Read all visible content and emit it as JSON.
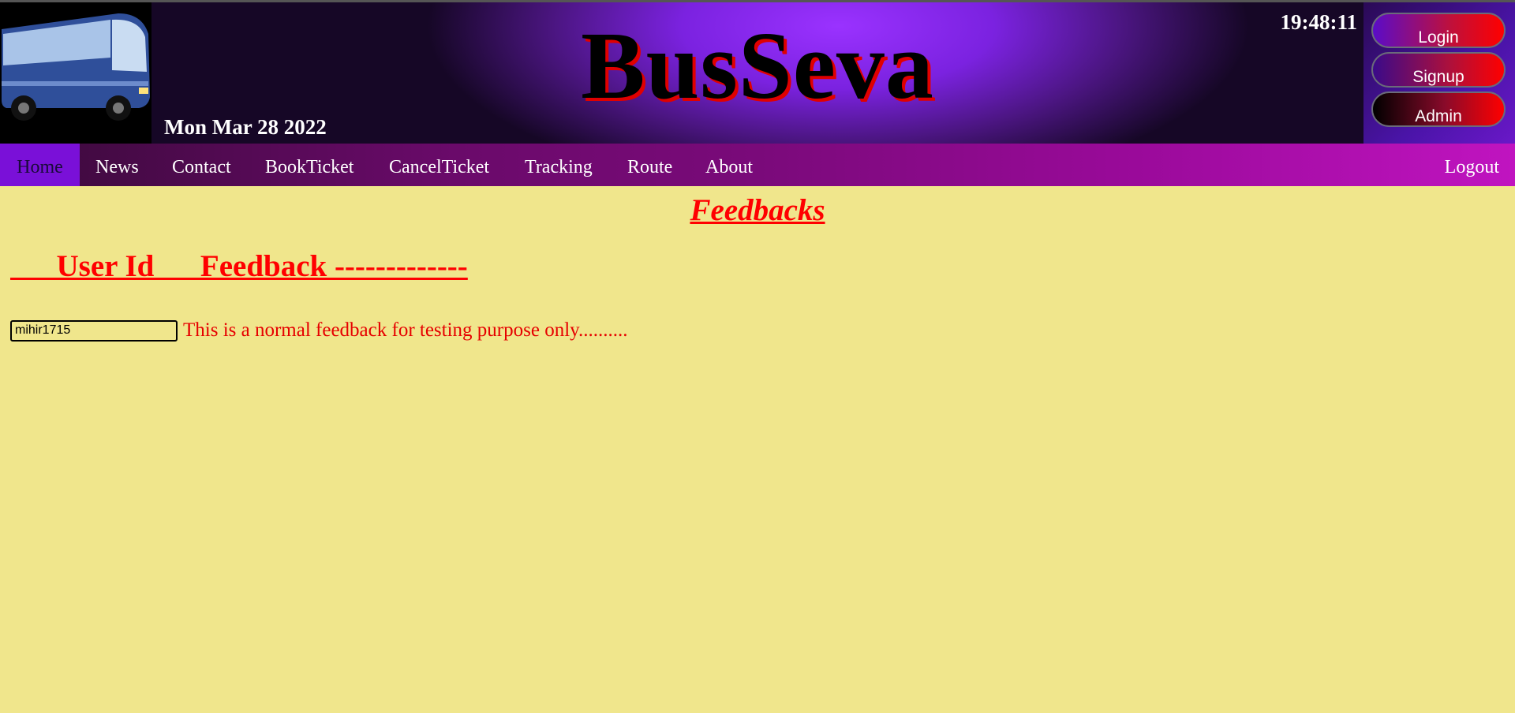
{
  "header": {
    "brand": "BusSeva",
    "date": "Mon Mar 28 2022",
    "time": "19:48:11",
    "auth_buttons": {
      "login": "Login",
      "signup": "Signup",
      "admin": "Admin"
    }
  },
  "nav": {
    "items": [
      {
        "label": "Home",
        "active": true
      },
      {
        "label": "News"
      },
      {
        "label": "Contact"
      },
      {
        "label": "BookTicket"
      },
      {
        "label": "CancelTicket"
      },
      {
        "label": "Tracking"
      },
      {
        "label": "Route"
      },
      {
        "label": "About"
      }
    ],
    "logout": "Logout"
  },
  "main": {
    "title": "Feedbacks",
    "columns_header": "      User Id      Feedback -------------",
    "feedbacks": [
      {
        "user_id": "mihir1715",
        "text": "This is a normal feedback for testing purpose only.........."
      }
    ]
  },
  "colors": {
    "page_background": "#f0e68c",
    "accent_red": "#ff0000",
    "nav_active": "#7a10d8"
  }
}
